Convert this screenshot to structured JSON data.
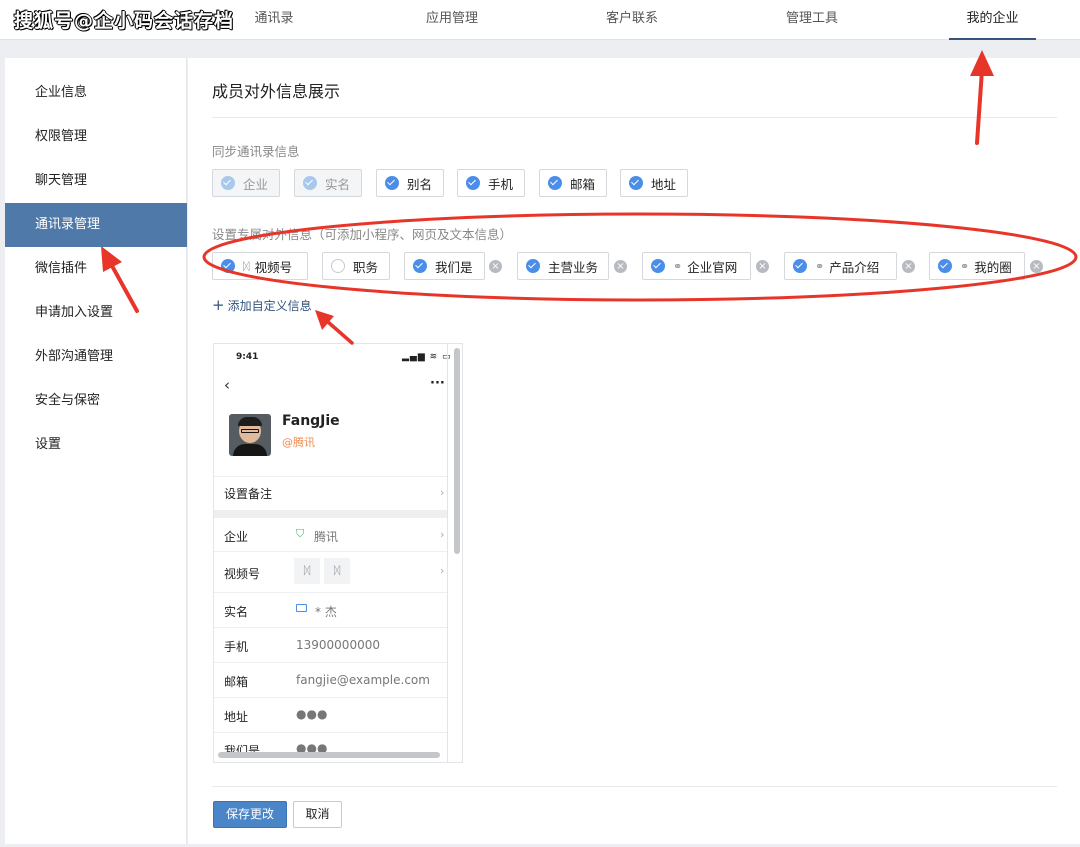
{
  "watermark": "搜狐号@企小码会话存档",
  "topnav": {
    "items": [
      {
        "label": "通讯录"
      },
      {
        "label": "应用管理"
      },
      {
        "label": "客户联系"
      },
      {
        "label": "管理工具"
      },
      {
        "label": "我的企业",
        "active": true
      }
    ]
  },
  "sidebar": {
    "items": [
      {
        "label": "企业信息"
      },
      {
        "label": "权限管理"
      },
      {
        "label": "聊天管理"
      },
      {
        "label": "通讯录管理",
        "active": true
      },
      {
        "label": "微信插件"
      },
      {
        "label": "申请加入设置"
      },
      {
        "label": "外部沟通管理"
      },
      {
        "label": "安全与保密"
      },
      {
        "label": "设置"
      }
    ]
  },
  "main": {
    "title": "成员对外信息展示",
    "sync_section": {
      "label": "同步通讯录信息",
      "options": [
        {
          "label": "企业",
          "checked": true,
          "disabled": true
        },
        {
          "label": "实名",
          "checked": true,
          "disabled": true
        },
        {
          "label": "别名",
          "checked": true
        },
        {
          "label": "手机",
          "checked": true
        },
        {
          "label": "邮箱",
          "checked": true
        },
        {
          "label": "地址",
          "checked": true
        }
      ]
    },
    "custom_section": {
      "label": "设置专属对外信息（可添加小程序、网页及文本信息）",
      "options": [
        {
          "label": "视频号",
          "checked": true,
          "icon": "channels-icon"
        },
        {
          "label": "职务",
          "checked": false
        },
        {
          "label": "我们是",
          "checked": true,
          "removable": true
        },
        {
          "label": "主营业务",
          "checked": true,
          "removable": true
        },
        {
          "label": "企业官网",
          "checked": true,
          "icon": "link-icon",
          "removable": true
        },
        {
          "label": "产品介绍",
          "checked": true,
          "icon": "link-icon",
          "removable": true
        },
        {
          "label": "我的圈",
          "checked": true,
          "icon": "link-icon",
          "removable": true
        }
      ],
      "add_label": "添加自定义信息"
    },
    "preview": {
      "time": "9:41",
      "name": "FangJie",
      "company_tag": "@腾讯",
      "remark_label": "设置备注",
      "rows": [
        {
          "label": "企业",
          "value": "腾讯"
        },
        {
          "label": "视频号",
          "value": ""
        },
        {
          "label": "实名",
          "value": "* 杰"
        },
        {
          "label": "手机",
          "value": "13900000000"
        },
        {
          "label": "邮箱",
          "value": "fangjie@example.com"
        },
        {
          "label": "地址",
          "value": "●●●"
        },
        {
          "label": "我们是",
          "value": "●●●"
        }
      ]
    },
    "save_label": "保存更改",
    "cancel_label": "取消"
  },
  "colors": {
    "accent": "#4e79a8",
    "checkbox": "#4a8eea",
    "annotation": "#e8352a",
    "company_tag": "#f08b4f"
  }
}
